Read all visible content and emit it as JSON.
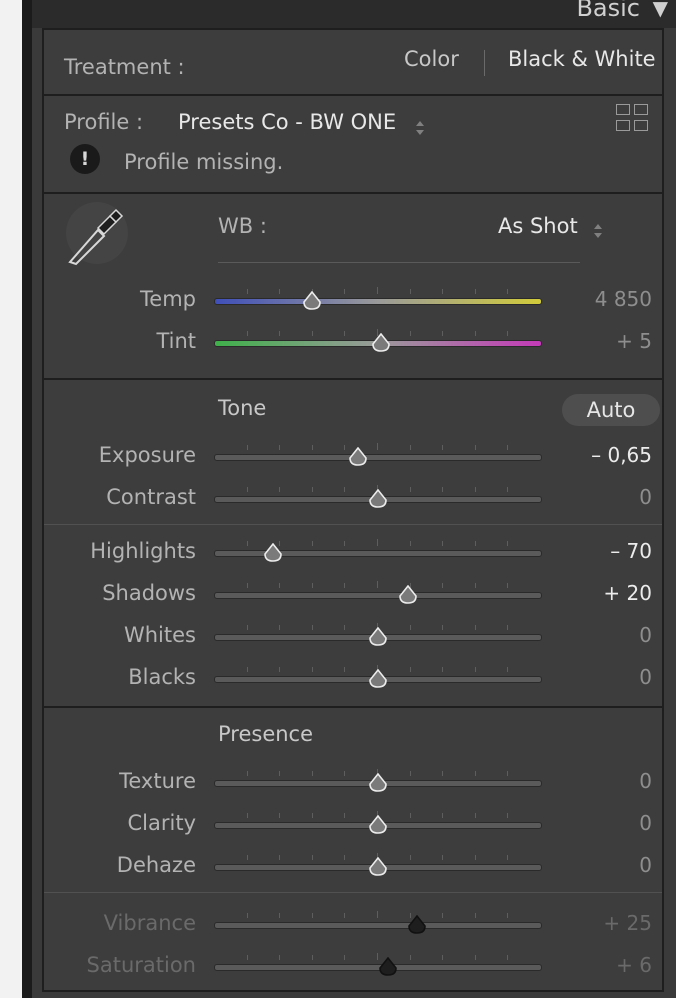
{
  "panel": {
    "title": "Basic"
  },
  "treatment": {
    "label": "Treatment :",
    "color_option": "Color",
    "bw_option": "Black & White"
  },
  "profile": {
    "label": "Profile :",
    "value": "Presets Co - BW ONE",
    "warning": "Profile missing."
  },
  "wb": {
    "label": "WB :",
    "value": "As Shot"
  },
  "tone": {
    "header": "Tone",
    "auto_label": "Auto"
  },
  "presence": {
    "header": "Presence"
  },
  "sliders": {
    "temp": {
      "label": "Temp",
      "value": "4 850",
      "position": 0.3
    },
    "tint": {
      "label": "Tint",
      "value": "+ 5",
      "position": 0.51
    },
    "exposure": {
      "label": "Exposure",
      "value": "– 0,65",
      "position": 0.44
    },
    "contrast": {
      "label": "Contrast",
      "value": "0",
      "position": 0.5
    },
    "highlights": {
      "label": "Highlights",
      "value": "– 70",
      "position": 0.18
    },
    "shadows": {
      "label": "Shadows",
      "value": "+ 20",
      "position": 0.59
    },
    "whites": {
      "label": "Whites",
      "value": "0",
      "position": 0.5
    },
    "blacks": {
      "label": "Blacks",
      "value": "0",
      "position": 0.5
    },
    "texture": {
      "label": "Texture",
      "value": "0",
      "position": 0.5
    },
    "clarity": {
      "label": "Clarity",
      "value": "0",
      "position": 0.5
    },
    "dehaze": {
      "label": "Dehaze",
      "value": "0",
      "position": 0.5
    },
    "vibrance": {
      "label": "Vibrance",
      "value": "+ 25",
      "position": 0.62
    },
    "saturation": {
      "label": "Saturation",
      "value": "+ 6",
      "position": 0.53
    }
  },
  "colors": {
    "panel_bg": "#3d3d3d",
    "text": "#b3b3b3",
    "text_bright": "#e8e8e8"
  },
  "icons": [
    "disclosure-triangle-icon",
    "profile-grid-icon",
    "warning-icon",
    "eyedropper-icon",
    "stepper-arrows-icon",
    "slider-thumb-icon"
  ]
}
